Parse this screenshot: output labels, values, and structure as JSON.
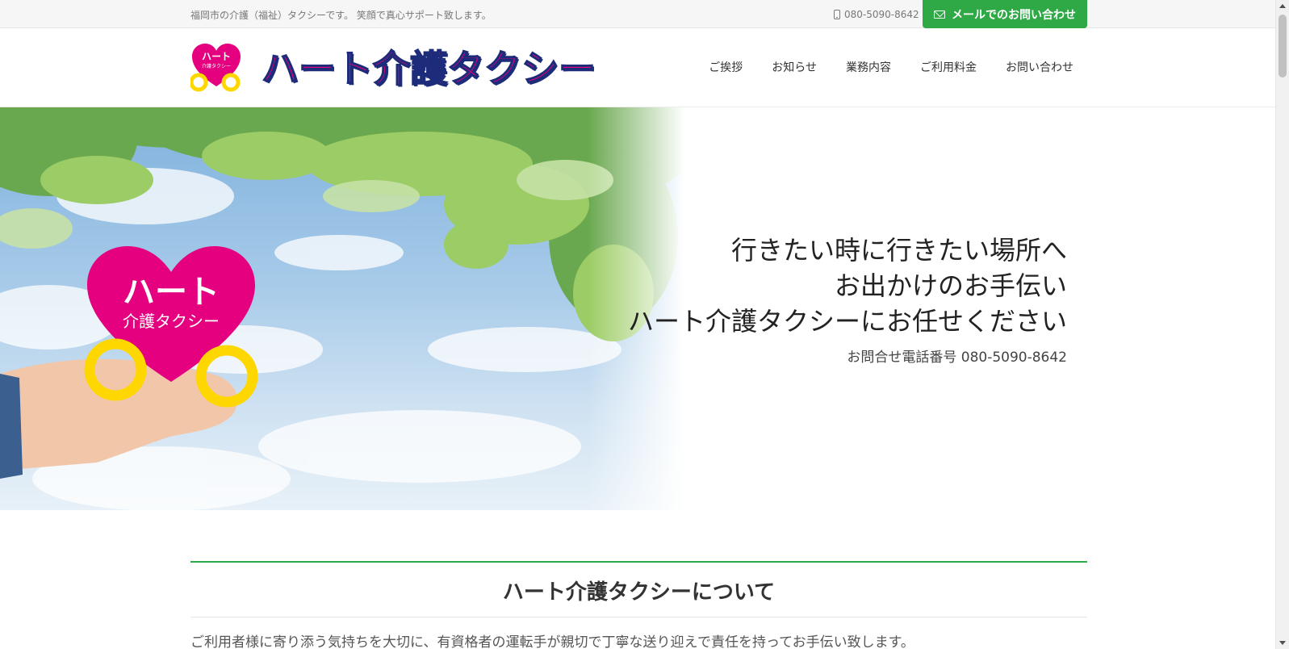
{
  "topbar": {
    "tagline": "福岡市の介護（福祉）タクシーです。 笑顔で真心サポート致します。",
    "phone": "080-5090-8642",
    "mail_button": "メールでのお問い合わせ"
  },
  "header": {
    "logo_text": "ハート介護タクシー",
    "logo_mark_text_top": "ハート",
    "logo_mark_text_bottom": "介護タクシー",
    "nav": [
      "ご挨拶",
      "お知らせ",
      "業務内容",
      "ご利用料金",
      "お問い合わせ"
    ]
  },
  "hero": {
    "lines": [
      "行きたい時に行きたい場所へ",
      "お出かけのお手伝い",
      "ハート介護タクシーにお任せください"
    ],
    "tel": "お問合せ電話番号 080-5090-8642",
    "heart_text_top": "ハート",
    "heart_text_bottom": "介護タクシー"
  },
  "about": {
    "title": "ハート介護タクシーについて",
    "body": "ご利用者様に寄り添う気持ちを大切に、有資格者の運転手が親切で丁寧な送り迎えで責任を持ってお手伝い致します。"
  },
  "colors": {
    "brand_pink": "#e4007f",
    "brand_navy": "#1d2c7a",
    "accent_green": "#2fa846",
    "wheel_yellow": "#ffd700"
  }
}
